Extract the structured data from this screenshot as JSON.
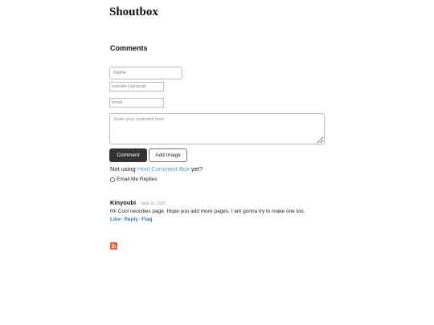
{
  "page": {
    "title": "Shoutbox"
  },
  "comments_section": {
    "heading": "Comments"
  },
  "form": {
    "name_placeholder": "Name",
    "website_placeholder": "website (optional)",
    "email_placeholder": "email",
    "comment_placeholder": "Enter your comment here",
    "comment_button": "Comment",
    "add_image_button": "Add Image",
    "not_using_prefix": "Not using",
    "html_comment_box_link": "Html Comment Box",
    "not_using_suffix": "yet?",
    "email_replies_label": "Email Me Replies"
  },
  "comments": [
    {
      "author": "Kinyoubi",
      "date": "Sept 16, 2021",
      "text": "Hi! Cool neocities page. Hope you add more pages. I am gonna try to make one too.",
      "actions": {
        "like": "Like",
        "reply": "Reply",
        "flag": "Flag",
        "separator": "·"
      }
    }
  ],
  "icons": {
    "rss": "rss-feed-icon"
  },
  "colors": {
    "primary_button": "#333333",
    "link": "#3b7fc4",
    "rss": "#e8542f"
  }
}
